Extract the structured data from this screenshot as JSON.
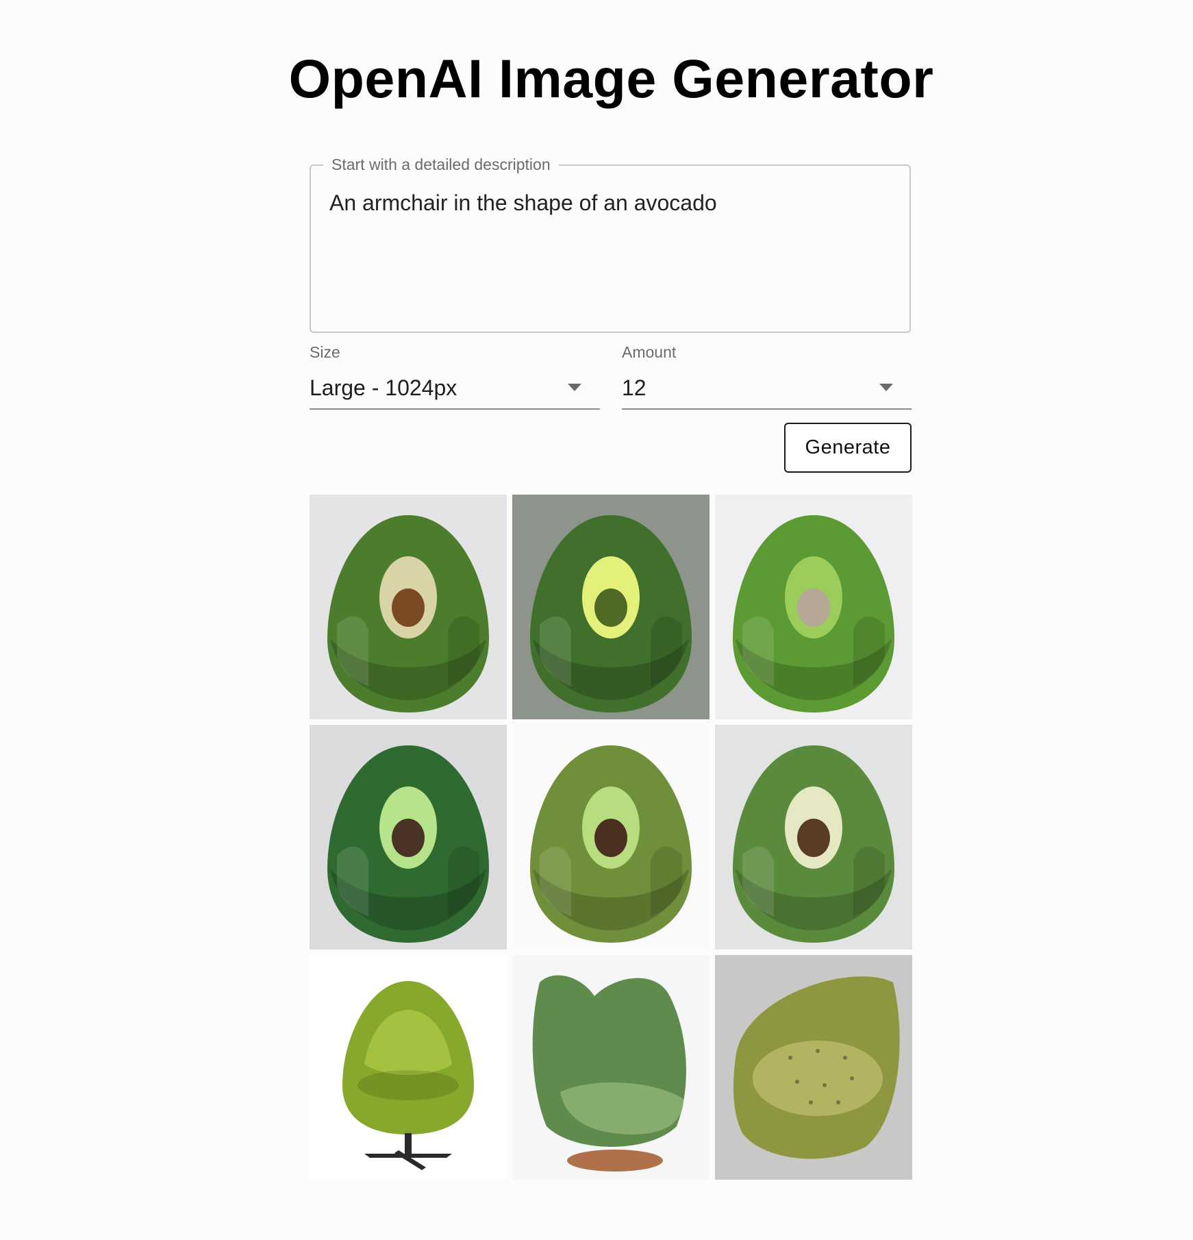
{
  "page": {
    "title": "OpenAI Image Generator"
  },
  "prompt": {
    "label": "Start with a detailed description",
    "value": "An armchair in the shape of an avocado"
  },
  "size": {
    "label": "Size",
    "value": "Large - 1024px"
  },
  "amount": {
    "label": "Amount",
    "value": "12"
  },
  "generate": {
    "label": "Generate"
  },
  "results": [
    {
      "icon": "avocado-armchair-image",
      "bg": "#e4e4e6",
      "chair": "#4b7d2c",
      "flesh": "#d9d4a6",
      "pit": "#7a4a24"
    },
    {
      "icon": "avocado-armchair-image",
      "bg": "#8d948c",
      "chair": "#41702d",
      "flesh": "#e3f07a",
      "pit": "#4f6a25"
    },
    {
      "icon": "avocado-armchair-image",
      "bg": "#efeff1",
      "chair": "#5c9a33",
      "flesh": "#9ccc5a",
      "pit": "#b5a896"
    },
    {
      "icon": "avocado-armchair-image",
      "bg": "#dcdcde",
      "chair": "#2f6a30",
      "flesh": "#b7e38a",
      "pit": "#4a3426"
    },
    {
      "icon": "avocado-armchair-image",
      "bg": "#fafafa",
      "chair": "#6f8f3a",
      "flesh": "#b7dd7f",
      "pit": "#4b3022"
    },
    {
      "icon": "avocado-armchair-image",
      "bg": "#e2e3e3",
      "chair": "#5a8a3c",
      "flesh": "#e6e8c4",
      "pit": "#5a3b25"
    },
    {
      "icon": "egg-armchair-image",
      "bg": "#ffffff",
      "chair": "#86a82b",
      "flesh": "#a4c240",
      "pit": "#2a2a2a"
    },
    {
      "icon": "wingback-armchair-image",
      "bg": "#f6f6f6",
      "chair": "#5f8b4c",
      "flesh": "#86ad6e",
      "pit": "#b0714a"
    },
    {
      "icon": "tufted-armchair-image",
      "bg": "#bdbdbd",
      "chair": "#8f9640",
      "flesh": "#b2b461",
      "pit": "#6a6a6a"
    }
  ]
}
